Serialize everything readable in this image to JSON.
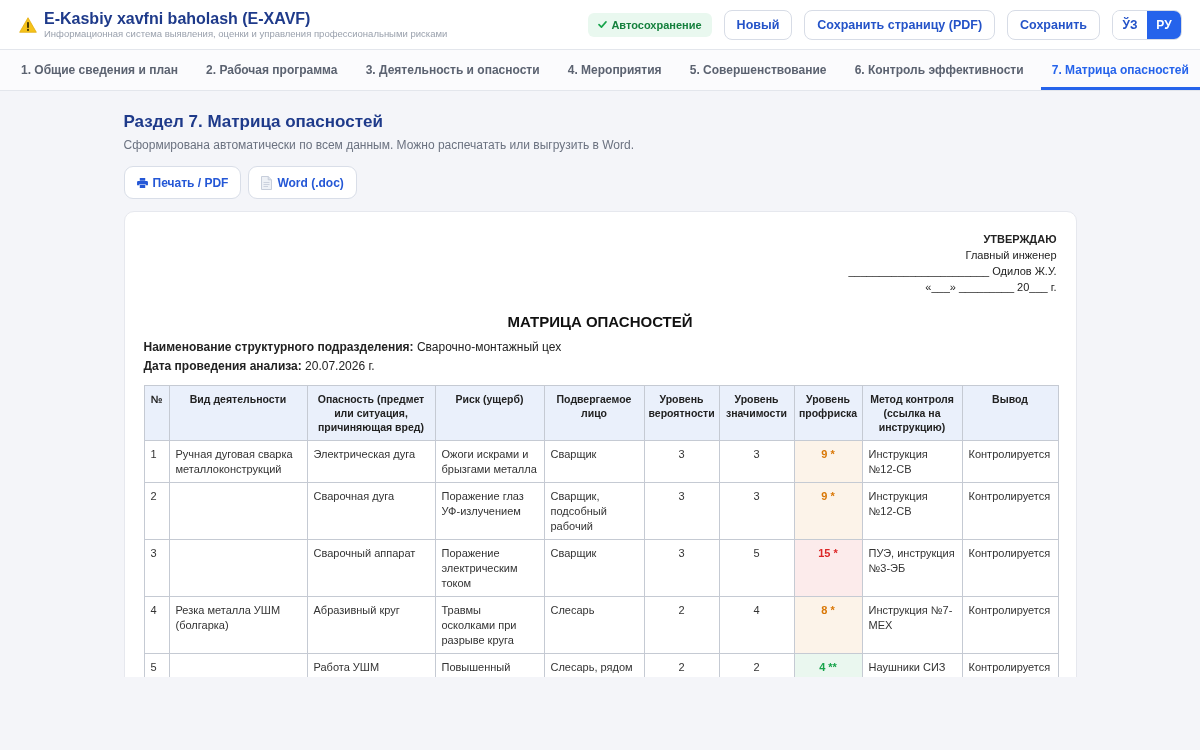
{
  "app": {
    "title": "E-Kasbiy xavfni baholash (E-XAVF)",
    "subtitle": "Информационная система выявления, оценки и управления профессиональными рисками"
  },
  "autosave": {
    "label": "Автосохранение"
  },
  "header_buttons": [
    "Новый",
    "Сохранить страницу (PDF)",
    "Сохранить"
  ],
  "languages": [
    {
      "label": "ЎЗ",
      "selected": false
    },
    {
      "label": "РУ",
      "selected": true
    }
  ],
  "tabs": [
    {
      "label": "1. Общие сведения и план",
      "selected": false
    },
    {
      "label": "2. Рабочая программа",
      "selected": false
    },
    {
      "label": "3. Деятельность и опасности",
      "selected": false
    },
    {
      "label": "4. Мероприятия",
      "selected": false
    },
    {
      "label": "5. Совершенствование",
      "selected": false
    },
    {
      "label": "6. Контроль эффективности",
      "selected": false
    },
    {
      "label": "7. Матрица опасностей",
      "selected": true
    }
  ],
  "section": {
    "title": "Раздел 7. Матрица опасностей",
    "description": "Сформирована автоматически по всем данным. Можно распечатать или выгрузить в Word.",
    "actions": [
      {
        "label": "Печать / PDF",
        "kind": "print"
      },
      {
        "label": "Word (.doc)",
        "kind": "word"
      }
    ]
  },
  "document": {
    "approval": {
      "heading": "УТВЕРЖДАЮ",
      "lines": [
        "Главный инженер",
        "_______________________ Одилов Ж.У.",
        "«___» _________ 20___ г."
      ]
    },
    "title": "МАТРИЦА ОПАСНОСТЕЙ",
    "fields": [
      "**Наименование структурного подразделения:** Сварочно-монтажный цех",
      "**Дата проведения анализа:** 20.07.2026 г."
    ],
    "table": {
      "columns": [
        "№",
        "Вид деятельности",
        "Опасность (предмет или ситуация, причиняющая вред)",
        "Риск (ущерб)",
        "Подвергаемое лицо",
        "Уровень вероятности",
        "Уровень значимости",
        "Уровень профриска",
        "Метод контроля (ссылка на инструкцию)",
        "Вывод"
      ],
      "rows": [
        {
          "number": "1",
          "activity": "Ручная дуговая сварка металлоконструкций",
          "hazard": "Электрическая дуга",
          "risk": "Ожоги искрами и брызгами металла",
          "person": "Сварщик",
          "probability": "3",
          "severity": "3",
          "risk_level": {
            "text": "9 *",
            "color": "#d97706"
          },
          "control": "Инструкция №12-СВ",
          "conclusion": "Контролируется"
        },
        {
          "number": "2",
          "hazard": "Сварочная дуга",
          "risk": "Поражение глаз УФ-излучением",
          "person": "Сварщик, подсобный рабочий",
          "probability": "3",
          "severity": "3",
          "risk_level": {
            "text": "9 *",
            "color": "#d97706"
          },
          "control": "Инструкция №12-СВ",
          "conclusion": "Контролируется"
        },
        {
          "number": "3",
          "hazard": "Сварочный аппарат",
          "risk": "Поражение электрическим током",
          "person": "Сварщик",
          "probability": "3",
          "severity": "5",
          "risk_level": {
            "text": "15 *",
            "color": "#dc2626"
          },
          "control": "ПУЭ, инструкция №3-ЭБ",
          "conclusion": "Контролируется"
        },
        {
          "number": "4",
          "activity": "Резка металла УШМ (болгарка)",
          "hazard": "Абразивный круг",
          "risk": "Травмы осколками при разрыве круга",
          "person": "Слесарь",
          "probability": "2",
          "severity": "4",
          "risk_level": {
            "text": "8 *",
            "color": "#d97706"
          },
          "control": "Инструкция №7-МЕХ",
          "conclusion": "Контролируется"
        },
        {
          "number": "5",
          "hazard": "Работа УШМ",
          "risk": "Повышенный",
          "person": "Слесарь, рядом",
          "probability": "2",
          "severity": "2",
          "risk_level": {
            "text": "4 **",
            "color": "#16a34a"
          },
          "control": "Наушники СИЗ",
          "conclusion": "Контролируется"
        }
      ]
    }
  }
}
